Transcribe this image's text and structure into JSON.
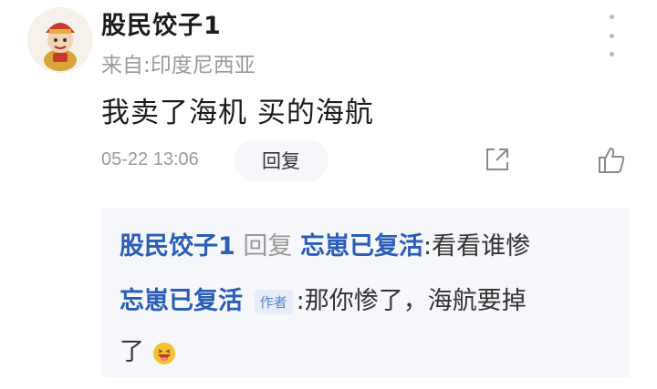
{
  "comment": {
    "username": "股民饺子1",
    "location": "来自:印度尼西亚",
    "content": "我卖了海机 买的海航",
    "time": "05-22 13:06",
    "reply_label": "回复"
  },
  "replies": [
    {
      "from": "股民饺子1",
      "reply_word": "回复",
      "to": "忘崽已复活",
      "separator": ":",
      "text": "看看谁惨"
    },
    {
      "from": "忘崽已复活",
      "author_tag": "作者",
      "separator": ":",
      "text_line1": "那你惨了，海航要掉",
      "text_line2": "了"
    }
  ],
  "icons": {
    "more": "more-vertical-icon",
    "share": "share-icon",
    "like": "thumbs-up-icon",
    "emoji": "laughing-emoji-icon"
  },
  "colors": {
    "link": "#2a5db8",
    "muted": "#9a9a9a",
    "reply_bg": "#f5f7fa",
    "tag_bg": "#e6edf8"
  }
}
